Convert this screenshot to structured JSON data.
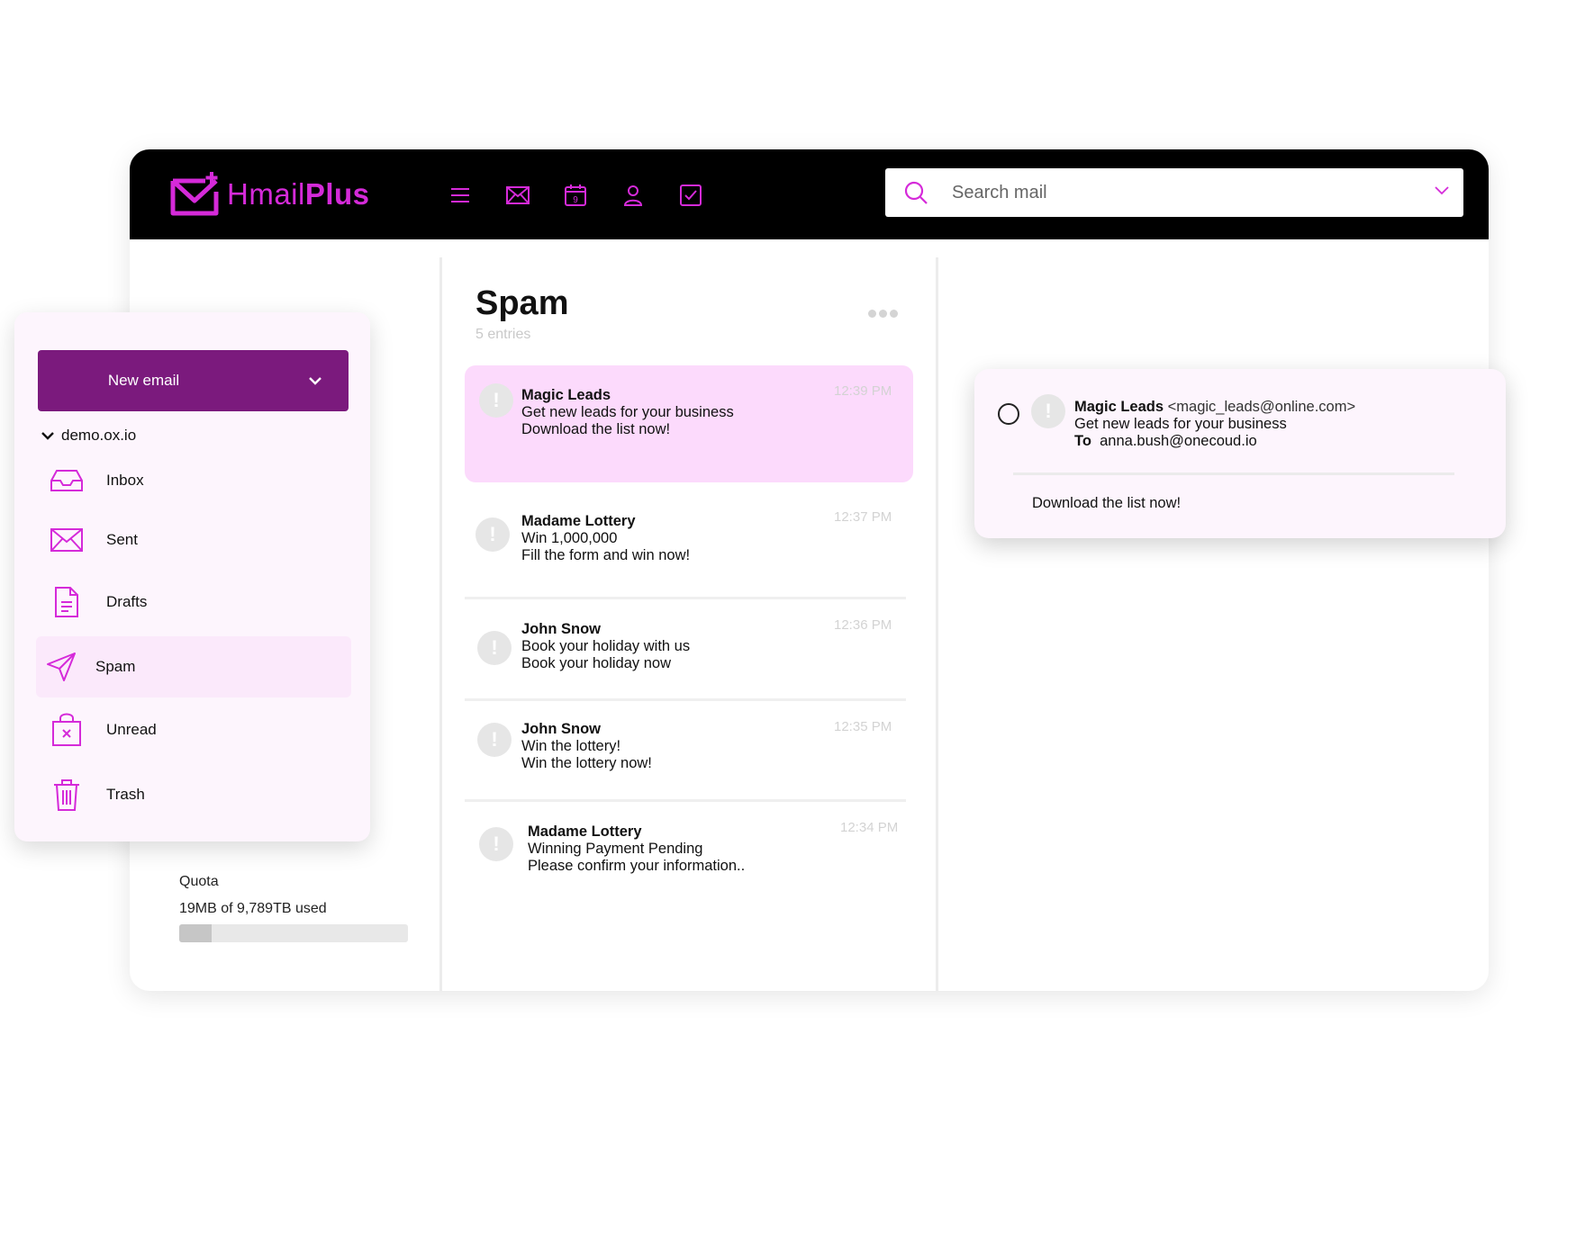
{
  "brand": {
    "name_light": "Hmail",
    "name_bold": "Plus",
    "accent": "#d52ad9",
    "primary": "#7b1a7d"
  },
  "header": {
    "nav": [
      {
        "name": "menu-icon"
      },
      {
        "name": "mail-icon"
      },
      {
        "name": "calendar-icon",
        "badge": "9"
      },
      {
        "name": "contacts-icon"
      },
      {
        "name": "tasks-icon"
      }
    ],
    "search": {
      "placeholder": "Search mail"
    }
  },
  "sidebar": {
    "new_email_label": "New email",
    "account": "demo.ox.io",
    "folders": [
      {
        "label": "Inbox",
        "icon": "inbox-icon"
      },
      {
        "label": "Sent",
        "icon": "envelope-icon"
      },
      {
        "label": "Drafts",
        "icon": "document-icon"
      },
      {
        "label": "Spam",
        "icon": "send-icon",
        "active": true
      },
      {
        "label": "Unread",
        "icon": "bag-icon"
      },
      {
        "label": "Trash",
        "icon": "trash-icon"
      }
    ]
  },
  "quota": {
    "title": "Quota",
    "used_text": "19MB of 9,789TB used",
    "fill_fraction": 0.14
  },
  "list": {
    "title": "Spam",
    "count": "5 entries",
    "items": [
      {
        "sender": "Magic Leads",
        "subject": "Get new leads for your business",
        "snippet": "Download the list now!",
        "time": "12:39 PM",
        "selected": true
      },
      {
        "sender": "Madame Lottery",
        "subject": "Win 1,000,000",
        "snippet": "Fill the form and win now!",
        "time": "12:37 PM"
      },
      {
        "sender": "John Snow",
        "subject": "Book your holiday with us",
        "snippet": "Book your holiday now",
        "time": "12:36 PM"
      },
      {
        "sender": "John Snow",
        "subject": "Win the lottery!",
        "snippet": "Win the lottery now!",
        "time": "12:35 PM"
      },
      {
        "sender": "Madame Lottery",
        "subject": "Winning Payment Pending",
        "snippet": "Please confirm your information..",
        "time": "12:34 PM"
      }
    ]
  },
  "preview": {
    "sender": "Magic Leads",
    "address": "<magic_leads@online.com>",
    "subject": "Get new leads for your business",
    "to_label": "To",
    "to": "anna.bush@onecoud.io",
    "body": "Download the list now!"
  }
}
